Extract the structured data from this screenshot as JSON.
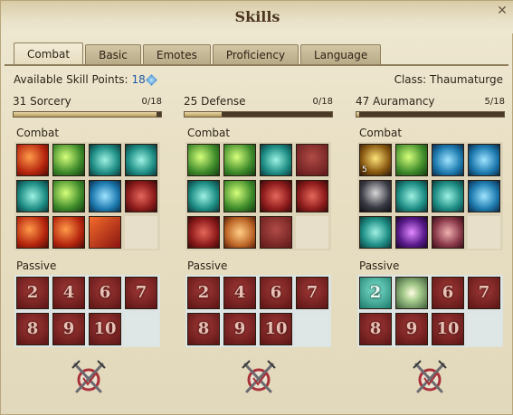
{
  "window": {
    "title": "Skills"
  },
  "tabs": [
    {
      "label": "Combat",
      "active": true
    },
    {
      "label": "Basic",
      "active": false
    },
    {
      "label": "Emotes",
      "active": false
    },
    {
      "label": "Proficiency",
      "active": false
    },
    {
      "label": "Language",
      "active": false
    }
  ],
  "info": {
    "skill_points_label": "Available Skill Points:",
    "skill_points_value": "18",
    "class_label": "Class: Thaumaturge"
  },
  "columns": [
    {
      "level_name": "31 Sorcery",
      "progress": "0/18",
      "progress_fraction": 0.97,
      "combat_label": "Combat",
      "passive_label": "Passive",
      "combat_icons": [
        "fire",
        "green",
        "teal",
        "teal",
        "teal",
        "green",
        "blue",
        "red",
        "fire",
        "fire",
        "fire2"
      ],
      "combat_icon_names": [
        "fireball-icon",
        "lightning-icon",
        "spear-icon",
        "storm-icon",
        "frost-icon",
        "burst-icon",
        "freeze-icon",
        "gem-icon",
        "flame-wave-icon",
        "meteor-icon",
        "inferno-icon"
      ],
      "passives": [
        "2",
        "4",
        "6",
        "7",
        "8",
        "9",
        "10"
      ]
    },
    {
      "level_name": "25 Defense",
      "progress": "0/18",
      "progress_fraction": 0.25,
      "combat_label": "Combat",
      "passive_label": "Passive",
      "combat_icons": [
        "green",
        "green",
        "teal",
        "maroon",
        "teal",
        "green",
        "red",
        "red",
        "red",
        "orange",
        "maroon"
      ],
      "combat_icon_names": [
        "shield-icon",
        "arrow-up-icon",
        "cloak-icon",
        "helm-icon",
        "toss-icon",
        "guard-icon",
        "armor-icon",
        "fist-icon",
        "strike-icon",
        "cube-icon",
        "flex-icon"
      ],
      "passives": [
        "2",
        "4",
        "6",
        "7",
        "8",
        "9",
        "10"
      ]
    },
    {
      "level_name": "47 Auramancy",
      "progress": "5/18",
      "progress_fraction": 0.02,
      "combat_label": "Combat",
      "passive_label": "Passive",
      "combat_icons": [
        "gold",
        "green",
        "blue",
        "blue",
        "dark",
        "teal",
        "teal",
        "blue",
        "teal",
        "purple",
        "pink"
      ],
      "combat_icon_names": [
        "hero-aura-icon",
        "radiance-icon",
        "aegis-icon",
        "star-burst-icon",
        "shadow-icon",
        "teleport-icon",
        "cloak-aura-icon",
        "mind-icon",
        "ice-wall-icon",
        "violet-hand-icon",
        "orb-icon"
      ],
      "combat_levels": [
        "5",
        "",
        "",
        "",
        "",
        "",
        "",
        "",
        "",
        "",
        ""
      ],
      "passives": [
        "2",
        "",
        "6",
        "7",
        "8",
        "9",
        "10"
      ],
      "passive_styles": [
        "teal",
        "glow",
        "",
        "",
        "",
        "",
        ""
      ]
    }
  ],
  "reset_buttons": [
    "reset-sorcery-button",
    "reset-defense-button",
    "reset-auramancy-button"
  ]
}
